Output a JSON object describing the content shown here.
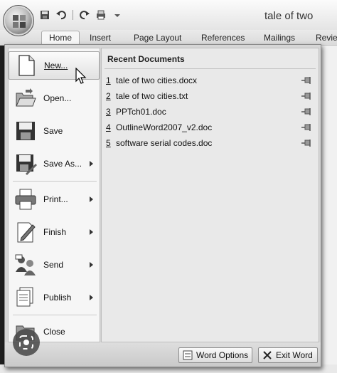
{
  "window": {
    "title": "tale of two"
  },
  "ribbon": {
    "tabs": [
      "Home",
      "Insert",
      "Page Layout",
      "References",
      "Mailings",
      "Revie"
    ]
  },
  "menu": {
    "commands": [
      {
        "label": "New...",
        "icon": "new-document-icon",
        "submenu": false
      },
      {
        "label": "Open...",
        "icon": "open-folder-icon",
        "submenu": false
      },
      {
        "label": "Save",
        "icon": "save-disk-icon",
        "submenu": false
      },
      {
        "label": "Save As...",
        "icon": "save-as-icon",
        "submenu": true
      },
      {
        "label": "Print...",
        "icon": "printer-icon",
        "submenu": true
      },
      {
        "label": "Finish",
        "icon": "finish-document-icon",
        "submenu": true
      },
      {
        "label": "Send",
        "icon": "send-people-icon",
        "submenu": true
      },
      {
        "label": "Publish",
        "icon": "publish-icon",
        "submenu": true
      },
      {
        "label": "Close",
        "icon": "close-folder-icon",
        "submenu": false
      }
    ],
    "recent": {
      "title": "Recent Documents",
      "items": [
        {
          "num": "1",
          "name": "tale of two cities.docx"
        },
        {
          "num": "2",
          "name": "tale of two cities.txt"
        },
        {
          "num": "3",
          "name": "PPTch01.doc"
        },
        {
          "num": "4",
          "name": "OutlineWord2007_v2.doc"
        },
        {
          "num": "5",
          "name": "software serial codes.doc"
        }
      ]
    },
    "footer": {
      "word_options": "Word Options",
      "exit_word": "Exit Word"
    }
  }
}
